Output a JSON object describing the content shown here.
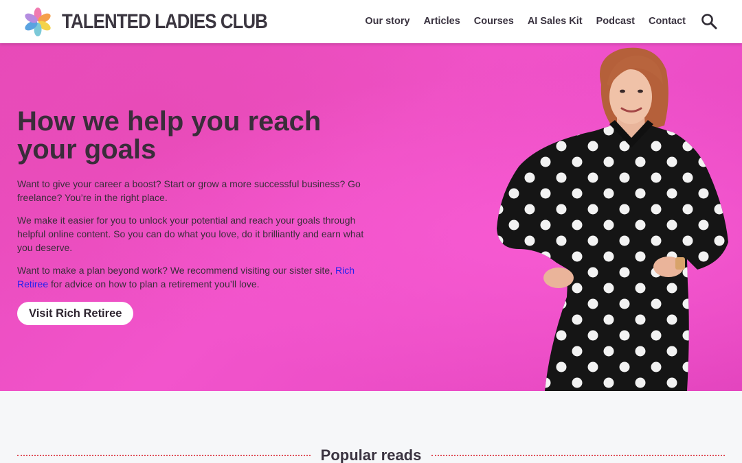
{
  "header": {
    "brand": "TALENTED LADIES CLUB",
    "logo_icon": "flower-petals-logo-icon",
    "nav": [
      {
        "label": "Our story"
      },
      {
        "label": "Articles"
      },
      {
        "label": "Courses"
      },
      {
        "label": "AI Sales Kit"
      },
      {
        "label": "Podcast"
      },
      {
        "label": "Contact"
      }
    ],
    "search_icon": "search-icon"
  },
  "hero": {
    "title": "How we help you reach your goals",
    "p1": "Want to give your career a boost? Start or grow a more successful business? Go freelance? You’re in the right place.",
    "p2": "We make it easier for you to unlock your potential and reach your goals through helpful online content. So you can do what you love, do it brilliantly and earn what you deserve.",
    "p3_before": "Want to make a plan beyond work? We recommend visiting our sister site, ",
    "p3_link": "Rich Retiree",
    "p3_after": " for advice on how to plan a retirement you’ll love.",
    "cta": "Visit Rich Retiree",
    "background_color": "#ef52c8"
  },
  "popular": {
    "title": "Popular reads"
  },
  "colors": {
    "accent_rule": "#e0505a",
    "link": "#2222ee",
    "text": "#3a3340"
  }
}
